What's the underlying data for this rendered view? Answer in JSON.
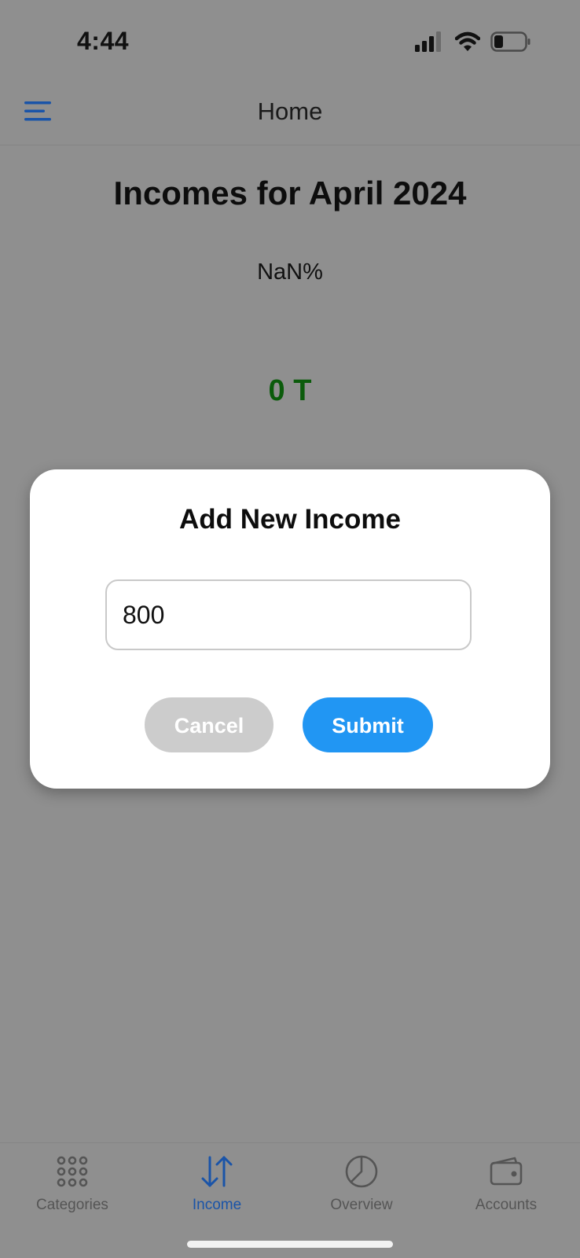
{
  "status_bar": {
    "time": "4:44"
  },
  "header": {
    "title": "Home",
    "menu_icon": "hamburger-menu-icon"
  },
  "main": {
    "heading": "Incomes for April 2024",
    "percent": "NaN%",
    "total": "0 T"
  },
  "modal": {
    "title": "Add New Income",
    "input_value": "800",
    "cancel_label": "Cancel",
    "submit_label": "Submit"
  },
  "tabs": [
    {
      "label": "Categories",
      "icon": "grid-dots-icon",
      "active": false
    },
    {
      "label": "Income",
      "icon": "arrows-swap-icon",
      "active": true
    },
    {
      "label": "Overview",
      "icon": "pie-chart-icon",
      "active": false
    },
    {
      "label": "Accounts",
      "icon": "wallet-icon",
      "active": false
    }
  ],
  "colors": {
    "overlay_background": "#8f8f8f",
    "accent": "#1a54a8",
    "submit": "#2196f3",
    "cancel": "#cccccc",
    "amount": "#0b5b0b"
  }
}
